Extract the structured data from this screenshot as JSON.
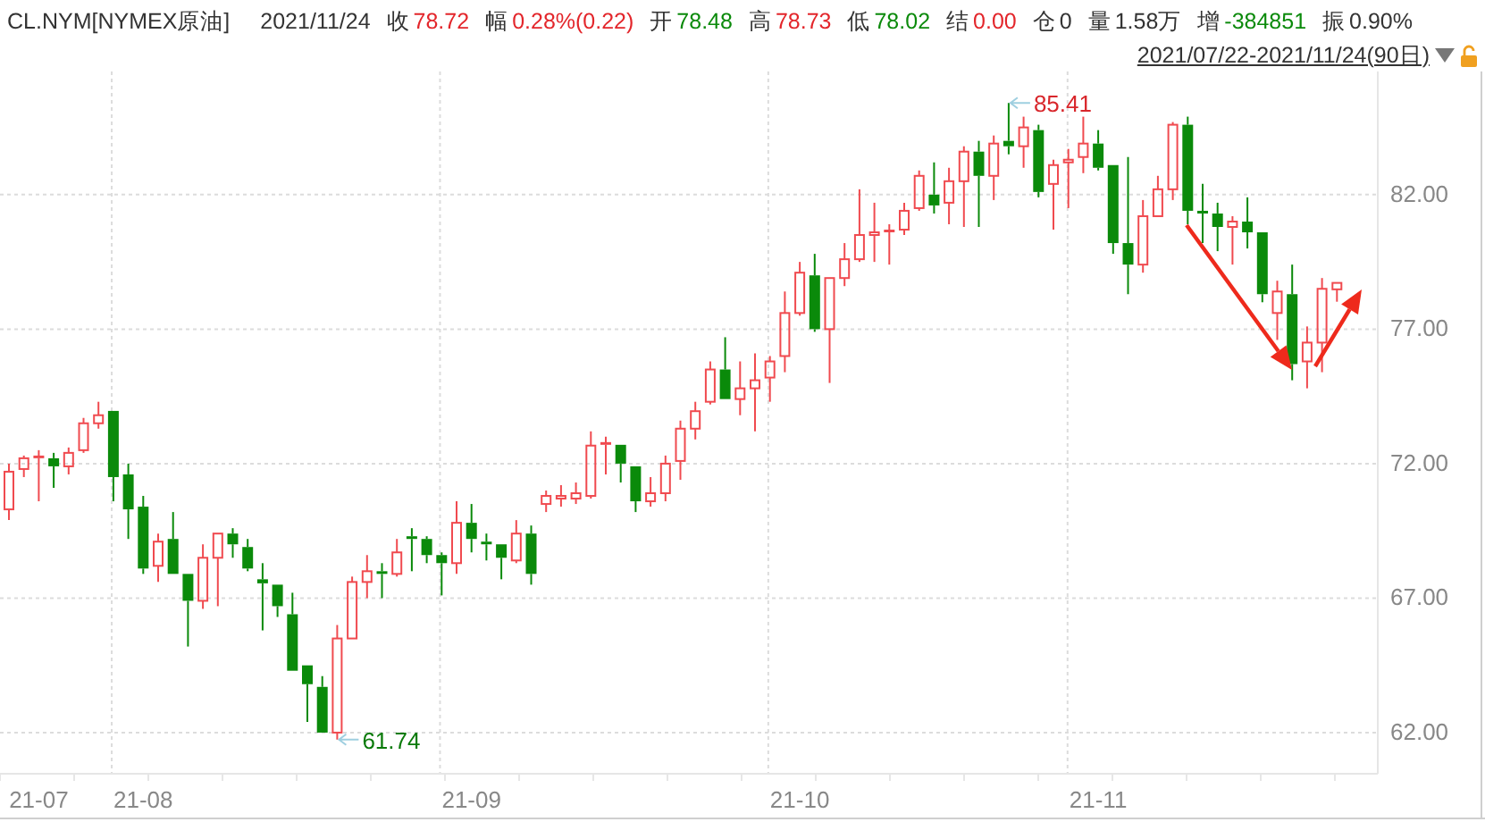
{
  "quote": {
    "symbol": "CL.NYM[NYMEX原油]",
    "date": "2021/11/24",
    "fields": [
      {
        "label": "收",
        "value": "78.72",
        "color": "#e3262b"
      },
      {
        "label": "幅",
        "value": "0.28%(0.22)",
        "color": "#e3262b"
      },
      {
        "label": "开",
        "value": "78.48",
        "color": "#0b8a0b"
      },
      {
        "label": "高",
        "value": "78.73",
        "color": "#e3262b"
      },
      {
        "label": "低",
        "value": "78.02",
        "color": "#0b8a0b"
      },
      {
        "label": "结",
        "value": "0.00",
        "color": "#e3262b"
      },
      {
        "label": "仓",
        "value": "0",
        "color": "#333333"
      },
      {
        "label": "量",
        "value": "1.58万",
        "color": "#333333"
      },
      {
        "label": "增",
        "value": "-384851",
        "color": "#0b8a0b"
      },
      {
        "label": "振",
        "value": "0.90%",
        "color": "#333333"
      }
    ]
  },
  "range": {
    "label": "2021/07/22-2021/11/24(90日)"
  },
  "chart": {
    "chart_data": {
      "type": "candlestick",
      "categories": [
        null,
        null,
        "21-07",
        null,
        null,
        null,
        null,
        null,
        null,
        "21-08",
        null,
        null,
        null,
        null,
        null,
        null,
        null,
        null,
        null,
        null,
        null,
        null,
        null,
        null,
        null,
        null,
        null,
        null,
        null,
        null,
        null,
        "21-09",
        null,
        null,
        null,
        null,
        null,
        null,
        null,
        null,
        null,
        null,
        null,
        null,
        null,
        null,
        null,
        null,
        null,
        null,
        null,
        null,
        null,
        "21-10",
        null,
        null,
        null,
        null,
        null,
        null,
        null,
        null,
        null,
        null,
        null,
        null,
        null,
        null,
        null,
        null,
        null,
        null,
        null,
        "21-11",
        null,
        null,
        null,
        null,
        null,
        null,
        null,
        null,
        null,
        null,
        null,
        null,
        null,
        null,
        null,
        null
      ],
      "grid": true,
      "ohlc": [
        [
          70.3,
          72.0,
          69.9,
          71.7
        ],
        [
          71.8,
          72.3,
          71.5,
          72.2
        ],
        [
          72.2,
          72.5,
          70.6,
          72.25
        ],
        [
          72.2,
          72.4,
          71.1,
          71.9
        ],
        [
          71.9,
          72.6,
          71.6,
          72.4
        ],
        [
          72.5,
          73.7,
          72.4,
          73.5
        ],
        [
          73.5,
          74.3,
          73.3,
          73.8
        ],
        [
          73.96,
          73.96,
          70.6,
          71.5
        ],
        [
          71.6,
          72.0,
          69.2,
          70.3
        ],
        [
          70.4,
          70.8,
          67.9,
          68.1
        ],
        [
          68.2,
          69.4,
          67.6,
          69.1
        ],
        [
          69.2,
          70.2,
          67.9,
          67.9
        ],
        [
          67.9,
          67.9,
          65.2,
          66.9
        ],
        [
          66.9,
          69.0,
          66.6,
          68.5
        ],
        [
          68.5,
          69.4,
          66.7,
          69.4
        ],
        [
          69.4,
          69.6,
          68.5,
          69.0
        ],
        [
          68.9,
          69.2,
          68.0,
          68.1
        ],
        [
          67.7,
          68.3,
          65.8,
          67.55
        ],
        [
          67.5,
          67.5,
          66.3,
          66.7
        ],
        [
          66.4,
          67.2,
          64.3,
          64.3
        ],
        [
          64.5,
          64.5,
          62.4,
          63.8
        ],
        [
          63.7,
          64.1,
          62.0,
          62.0
        ],
        [
          62.0,
          66.0,
          61.74,
          65.5
        ],
        [
          65.5,
          67.8,
          65.5,
          67.6
        ],
        [
          67.6,
          68.6,
          67.0,
          68.0
        ],
        [
          68.0,
          68.3,
          67.0,
          67.9
        ],
        [
          67.9,
          69.2,
          67.8,
          68.7
        ],
        [
          69.3,
          69.6,
          68.0,
          69.2
        ],
        [
          69.2,
          69.3,
          68.3,
          68.6
        ],
        [
          68.6,
          68.7,
          67.1,
          68.3
        ],
        [
          68.3,
          70.6,
          67.9,
          69.8
        ],
        [
          69.8,
          70.5,
          68.7,
          69.2
        ],
        [
          69.1,
          69.4,
          68.4,
          69.0
        ],
        [
          69.0,
          69.0,
          67.7,
          68.5
        ],
        [
          68.4,
          69.9,
          68.3,
          69.4
        ],
        [
          69.4,
          69.7,
          67.5,
          67.9
        ],
        [
          70.5,
          71.0,
          70.2,
          70.8
        ],
        [
          70.7,
          71.2,
          70.4,
          70.8
        ],
        [
          70.7,
          71.3,
          70.5,
          70.9
        ],
        [
          70.8,
          73.2,
          70.7,
          72.67
        ],
        [
          72.7,
          73.0,
          71.6,
          72.75
        ],
        [
          72.7,
          72.7,
          71.3,
          72.0
        ],
        [
          71.9,
          71.9,
          70.2,
          70.6
        ],
        [
          70.6,
          71.5,
          70.4,
          70.9
        ],
        [
          70.9,
          72.3,
          70.6,
          72.0
        ],
        [
          72.1,
          73.6,
          71.4,
          73.3
        ],
        [
          73.3,
          74.3,
          72.9,
          73.95
        ],
        [
          74.3,
          75.8,
          74.2,
          75.5
        ],
        [
          75.5,
          76.7,
          74.4,
          74.4
        ],
        [
          74.4,
          75.8,
          73.8,
          74.8
        ],
        [
          74.8,
          76.1,
          73.2,
          75.1
        ],
        [
          75.2,
          76.0,
          74.3,
          75.8
        ],
        [
          76.0,
          78.4,
          75.4,
          77.6
        ],
        [
          77.6,
          79.5,
          77.5,
          79.1
        ],
        [
          79.0,
          79.8,
          76.9,
          77.0
        ],
        [
          77.0,
          78.9,
          75.0,
          78.9
        ],
        [
          78.9,
          80.2,
          78.6,
          79.6
        ],
        [
          79.6,
          82.2,
          79.5,
          80.5
        ],
        [
          80.5,
          81.7,
          79.5,
          80.6
        ],
        [
          80.6,
          80.9,
          79.4,
          80.65
        ],
        [
          80.7,
          81.7,
          80.5,
          81.4
        ],
        [
          81.5,
          82.9,
          81.4,
          82.7
        ],
        [
          82.0,
          83.2,
          81.3,
          81.6
        ],
        [
          81.7,
          83.0,
          80.9,
          82.5
        ],
        [
          82.5,
          83.8,
          80.8,
          83.6
        ],
        [
          83.6,
          84.0,
          80.8,
          82.7
        ],
        [
          82.7,
          84.2,
          81.8,
          83.9
        ],
        [
          84.0,
          85.41,
          83.5,
          83.8
        ],
        [
          83.8,
          84.9,
          83.0,
          84.5
        ],
        [
          84.4,
          84.6,
          81.9,
          82.1
        ],
        [
          82.4,
          83.3,
          80.7,
          83.1
        ],
        [
          83.2,
          83.7,
          81.5,
          83.3
        ],
        [
          83.4,
          84.9,
          82.8,
          83.9
        ],
        [
          83.9,
          84.4,
          82.9,
          83.0
        ],
        [
          83.1,
          83.1,
          79.8,
          80.2
        ],
        [
          80.2,
          83.4,
          78.3,
          79.4
        ],
        [
          79.4,
          81.8,
          79.1,
          81.2
        ],
        [
          81.2,
          82.7,
          81.2,
          82.2
        ],
        [
          82.2,
          84.7,
          81.8,
          84.6
        ],
        [
          84.6,
          84.9,
          80.9,
          81.4
        ],
        [
          81.4,
          82.4,
          80.2,
          81.3
        ],
        [
          81.3,
          81.7,
          79.9,
          80.8
        ],
        [
          80.8,
          81.2,
          79.4,
          81.0
        ],
        [
          81.0,
          81.9,
          80.0,
          80.6
        ],
        [
          80.6,
          80.6,
          78.0,
          78.3
        ],
        [
          77.6,
          78.8,
          76.6,
          78.4
        ],
        [
          78.3,
          79.4,
          75.1,
          75.7
        ],
        [
          75.8,
          77.1,
          74.8,
          76.5
        ],
        [
          76.5,
          78.9,
          75.4,
          78.5
        ],
        [
          78.48,
          78.73,
          78.02,
          78.72
        ]
      ],
      "ylim": [
        60.47,
        86.58
      ],
      "yticks": [
        {
          "value": 82,
          "label": "82.00"
        },
        {
          "value": 77,
          "label": "77.00"
        },
        {
          "value": 72,
          "label": "72.00"
        },
        {
          "value": 67,
          "label": "67.00"
        },
        {
          "value": 62,
          "label": "62.00"
        }
      ],
      "annotations": [
        "85.41",
        "61.74"
      ]
    }
  }
}
